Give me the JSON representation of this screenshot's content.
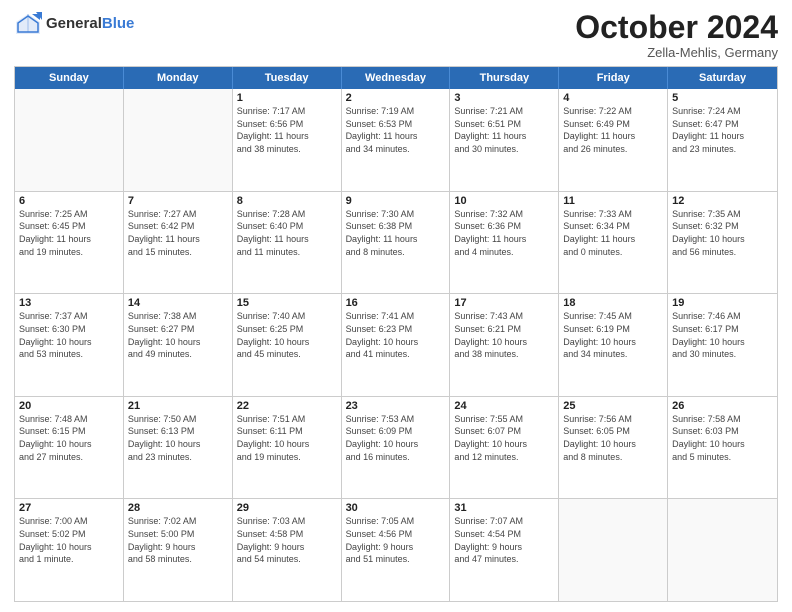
{
  "header": {
    "logo_general": "General",
    "logo_blue": "Blue",
    "title": "October 2024",
    "location": "Zella-Mehlis, Germany"
  },
  "weekdays": [
    "Sunday",
    "Monday",
    "Tuesday",
    "Wednesday",
    "Thursday",
    "Friday",
    "Saturday"
  ],
  "rows": [
    [
      {
        "day": "",
        "lines": []
      },
      {
        "day": "",
        "lines": []
      },
      {
        "day": "1",
        "lines": [
          "Sunrise: 7:17 AM",
          "Sunset: 6:56 PM",
          "Daylight: 11 hours",
          "and 38 minutes."
        ]
      },
      {
        "day": "2",
        "lines": [
          "Sunrise: 7:19 AM",
          "Sunset: 6:53 PM",
          "Daylight: 11 hours",
          "and 34 minutes."
        ]
      },
      {
        "day": "3",
        "lines": [
          "Sunrise: 7:21 AM",
          "Sunset: 6:51 PM",
          "Daylight: 11 hours",
          "and 30 minutes."
        ]
      },
      {
        "day": "4",
        "lines": [
          "Sunrise: 7:22 AM",
          "Sunset: 6:49 PM",
          "Daylight: 11 hours",
          "and 26 minutes."
        ]
      },
      {
        "day": "5",
        "lines": [
          "Sunrise: 7:24 AM",
          "Sunset: 6:47 PM",
          "Daylight: 11 hours",
          "and 23 minutes."
        ]
      }
    ],
    [
      {
        "day": "6",
        "lines": [
          "Sunrise: 7:25 AM",
          "Sunset: 6:45 PM",
          "Daylight: 11 hours",
          "and 19 minutes."
        ]
      },
      {
        "day": "7",
        "lines": [
          "Sunrise: 7:27 AM",
          "Sunset: 6:42 PM",
          "Daylight: 11 hours",
          "and 15 minutes."
        ]
      },
      {
        "day": "8",
        "lines": [
          "Sunrise: 7:28 AM",
          "Sunset: 6:40 PM",
          "Daylight: 11 hours",
          "and 11 minutes."
        ]
      },
      {
        "day": "9",
        "lines": [
          "Sunrise: 7:30 AM",
          "Sunset: 6:38 PM",
          "Daylight: 11 hours",
          "and 8 minutes."
        ]
      },
      {
        "day": "10",
        "lines": [
          "Sunrise: 7:32 AM",
          "Sunset: 6:36 PM",
          "Daylight: 11 hours",
          "and 4 minutes."
        ]
      },
      {
        "day": "11",
        "lines": [
          "Sunrise: 7:33 AM",
          "Sunset: 6:34 PM",
          "Daylight: 11 hours",
          "and 0 minutes."
        ]
      },
      {
        "day": "12",
        "lines": [
          "Sunrise: 7:35 AM",
          "Sunset: 6:32 PM",
          "Daylight: 10 hours",
          "and 56 minutes."
        ]
      }
    ],
    [
      {
        "day": "13",
        "lines": [
          "Sunrise: 7:37 AM",
          "Sunset: 6:30 PM",
          "Daylight: 10 hours",
          "and 53 minutes."
        ]
      },
      {
        "day": "14",
        "lines": [
          "Sunrise: 7:38 AM",
          "Sunset: 6:27 PM",
          "Daylight: 10 hours",
          "and 49 minutes."
        ]
      },
      {
        "day": "15",
        "lines": [
          "Sunrise: 7:40 AM",
          "Sunset: 6:25 PM",
          "Daylight: 10 hours",
          "and 45 minutes."
        ]
      },
      {
        "day": "16",
        "lines": [
          "Sunrise: 7:41 AM",
          "Sunset: 6:23 PM",
          "Daylight: 10 hours",
          "and 41 minutes."
        ]
      },
      {
        "day": "17",
        "lines": [
          "Sunrise: 7:43 AM",
          "Sunset: 6:21 PM",
          "Daylight: 10 hours",
          "and 38 minutes."
        ]
      },
      {
        "day": "18",
        "lines": [
          "Sunrise: 7:45 AM",
          "Sunset: 6:19 PM",
          "Daylight: 10 hours",
          "and 34 minutes."
        ]
      },
      {
        "day": "19",
        "lines": [
          "Sunrise: 7:46 AM",
          "Sunset: 6:17 PM",
          "Daylight: 10 hours",
          "and 30 minutes."
        ]
      }
    ],
    [
      {
        "day": "20",
        "lines": [
          "Sunrise: 7:48 AM",
          "Sunset: 6:15 PM",
          "Daylight: 10 hours",
          "and 27 minutes."
        ]
      },
      {
        "day": "21",
        "lines": [
          "Sunrise: 7:50 AM",
          "Sunset: 6:13 PM",
          "Daylight: 10 hours",
          "and 23 minutes."
        ]
      },
      {
        "day": "22",
        "lines": [
          "Sunrise: 7:51 AM",
          "Sunset: 6:11 PM",
          "Daylight: 10 hours",
          "and 19 minutes."
        ]
      },
      {
        "day": "23",
        "lines": [
          "Sunrise: 7:53 AM",
          "Sunset: 6:09 PM",
          "Daylight: 10 hours",
          "and 16 minutes."
        ]
      },
      {
        "day": "24",
        "lines": [
          "Sunrise: 7:55 AM",
          "Sunset: 6:07 PM",
          "Daylight: 10 hours",
          "and 12 minutes."
        ]
      },
      {
        "day": "25",
        "lines": [
          "Sunrise: 7:56 AM",
          "Sunset: 6:05 PM",
          "Daylight: 10 hours",
          "and 8 minutes."
        ]
      },
      {
        "day": "26",
        "lines": [
          "Sunrise: 7:58 AM",
          "Sunset: 6:03 PM",
          "Daylight: 10 hours",
          "and 5 minutes."
        ]
      }
    ],
    [
      {
        "day": "27",
        "lines": [
          "Sunrise: 7:00 AM",
          "Sunset: 5:02 PM",
          "Daylight: 10 hours",
          "and 1 minute."
        ]
      },
      {
        "day": "28",
        "lines": [
          "Sunrise: 7:02 AM",
          "Sunset: 5:00 PM",
          "Daylight: 9 hours",
          "and 58 minutes."
        ]
      },
      {
        "day": "29",
        "lines": [
          "Sunrise: 7:03 AM",
          "Sunset: 4:58 PM",
          "Daylight: 9 hours",
          "and 54 minutes."
        ]
      },
      {
        "day": "30",
        "lines": [
          "Sunrise: 7:05 AM",
          "Sunset: 4:56 PM",
          "Daylight: 9 hours",
          "and 51 minutes."
        ]
      },
      {
        "day": "31",
        "lines": [
          "Sunrise: 7:07 AM",
          "Sunset: 4:54 PM",
          "Daylight: 9 hours",
          "and 47 minutes."
        ]
      },
      {
        "day": "",
        "lines": []
      },
      {
        "day": "",
        "lines": []
      }
    ]
  ]
}
